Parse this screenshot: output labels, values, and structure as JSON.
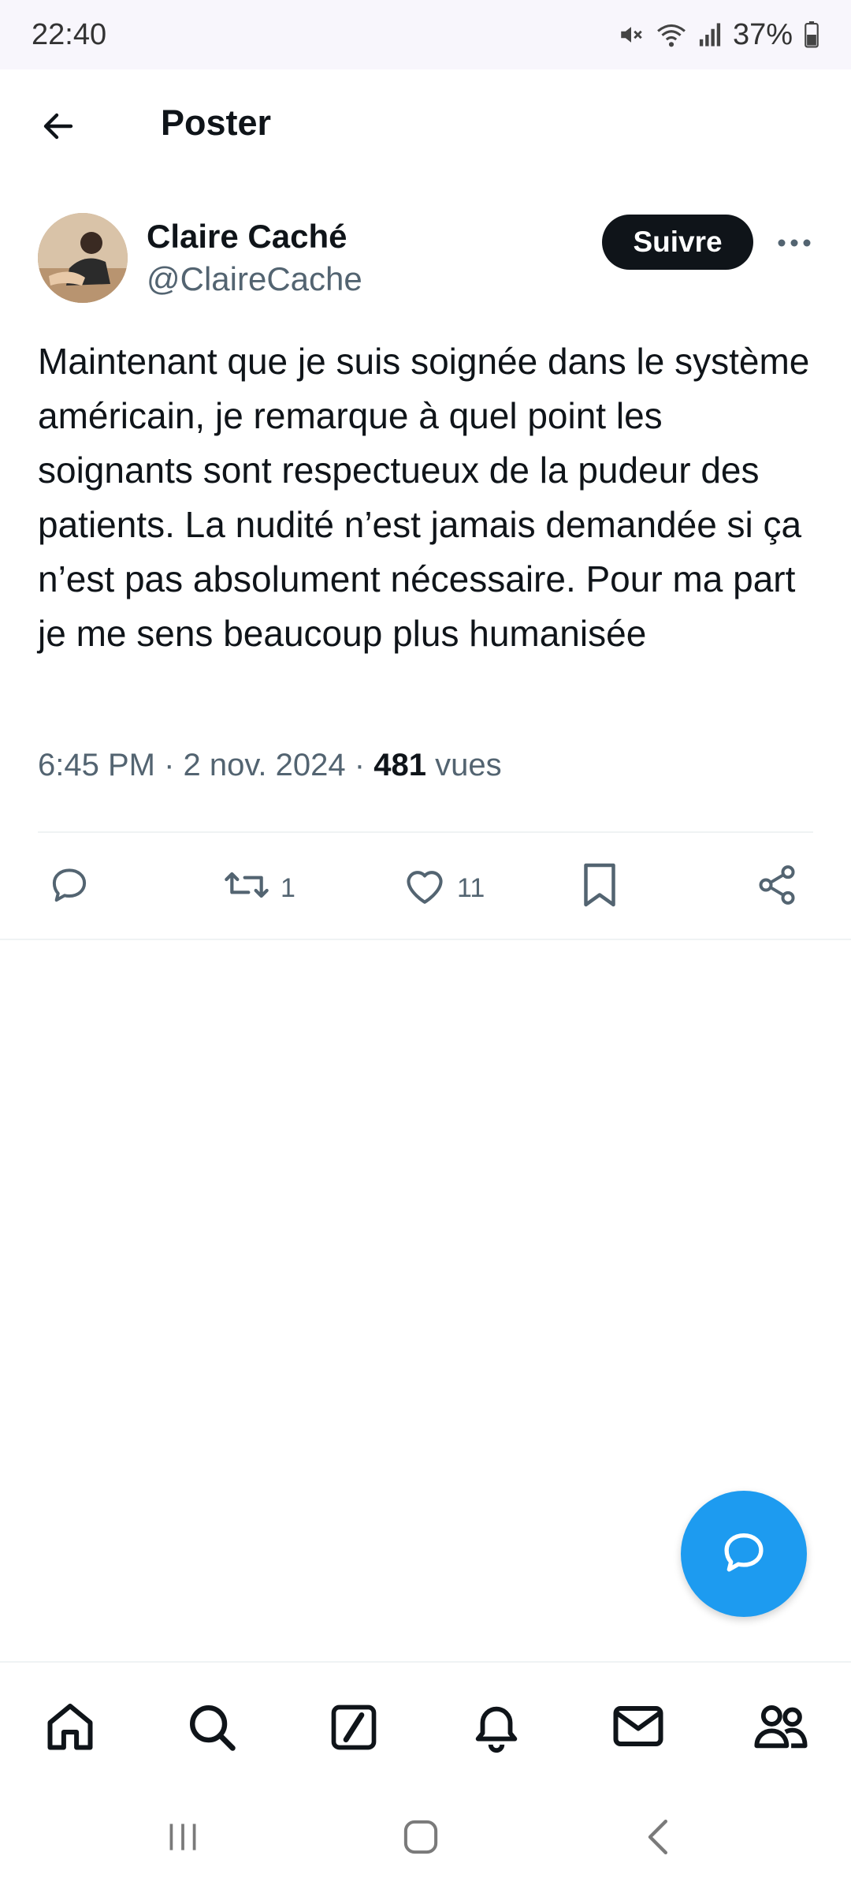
{
  "status_bar": {
    "time": "22:40",
    "battery": "37%",
    "icons": [
      "mute-icon",
      "wifi-icon",
      "signal-icon",
      "battery-icon"
    ]
  },
  "header": {
    "title": "Poster",
    "back_icon": "arrow-left-icon"
  },
  "post": {
    "author_name": "Claire Caché",
    "author_handle": "@ClaireCache",
    "follow_label": "Suivre",
    "text": "Maintenant que je suis soignée dans le système américain, je remarque à quel point les soignants sont respectueux de la pudeur des patients. La nudité n’est jamais demandée si ça n’est pas absolument nécessaire. Pour ma part je me sens beaucoup plus humanisée",
    "time": "6:45 PM",
    "date": "2 nov. 2024",
    "views_count": "481",
    "views_label": "vues",
    "separator": "·"
  },
  "actions": {
    "reply_count": "",
    "repost_count": "1",
    "like_count": "11"
  },
  "bottom_nav": {
    "items": [
      "home-icon",
      "search-icon",
      "grok-icon",
      "notifications-icon",
      "messages-icon",
      "communities-icon"
    ]
  },
  "colors": {
    "accent": "#1d9bf0",
    "text": "#0f1419",
    "secondary": "#536471",
    "status_bar_bg": "#f8f6fc"
  }
}
